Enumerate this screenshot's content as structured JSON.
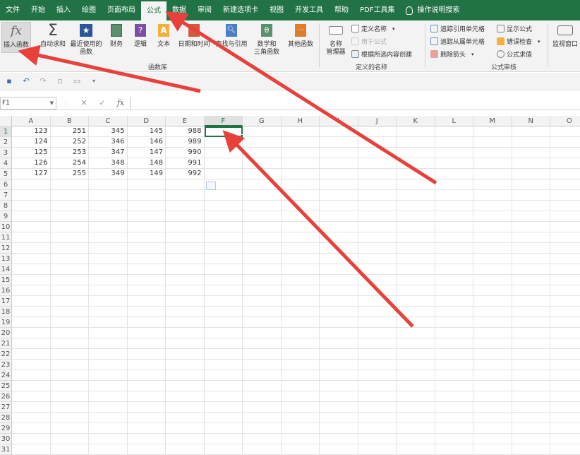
{
  "tabs": [
    "文件",
    "开始",
    "插入",
    "绘图",
    "页面布局",
    "公式",
    "数据",
    "审阅",
    "新建选项卡",
    "视图",
    "开发工具",
    "帮助",
    "PDF工具集"
  ],
  "active_tab": "公式",
  "tell_me": "操作说明搜索",
  "ribbon": {
    "function_library": {
      "label": "函数库",
      "buttons": {
        "insert_function": "插入函数",
        "autosum": "自动求和",
        "recent_1": "最近使用的",
        "recent_2": "函数",
        "financial": "财务",
        "logical": "逻辑",
        "text": "文本",
        "datetime": "日期和时间",
        "lookup": "查找与引用",
        "math_1": "数学和",
        "math_2": "三角函数",
        "more": "其他函数"
      }
    },
    "defined_names": {
      "label": "定义的名称",
      "name_manager_1": "名称",
      "name_manager_2": "管理器",
      "define_name": "定义名称",
      "use_in_formula": "用于公式",
      "create_from_selection": "根据所选内容创建"
    },
    "formula_auditing": {
      "label": "公式审核",
      "trace_precedents": "追踪引用单元格",
      "trace_dependents": "追踪从属单元格",
      "remove_arrows": "删除箭头",
      "show_formulas": "显示公式",
      "error_checking": "错误检查",
      "evaluate_formula": "公式求值"
    },
    "watch_window": "监视窗口"
  },
  "formula_bar": {
    "name_box": "F1",
    "cancel": "✕",
    "enter": "✓",
    "fx": "fx",
    "content": ""
  },
  "columns": [
    "A",
    "B",
    "C",
    "D",
    "E",
    "F",
    "G",
    "H",
    "I",
    "J",
    "K",
    "L",
    "M",
    "N",
    "O"
  ],
  "selected_column": "F",
  "rows": [
    "1",
    "2",
    "3",
    "4",
    "5",
    "6",
    "7",
    "8",
    "9",
    "10",
    "11",
    "12",
    "13",
    "14",
    "15",
    "16",
    "17",
    "18",
    "19",
    "20",
    "21",
    "22",
    "23",
    "24",
    "25",
    "26",
    "27",
    "28",
    "29",
    "30",
    "31"
  ],
  "selected_row": "1",
  "cells": [
    [
      "123",
      "251",
      "345",
      "145",
      "988"
    ],
    [
      "124",
      "252",
      "346",
      "146",
      "989"
    ],
    [
      "125",
      "253",
      "347",
      "147",
      "990"
    ],
    [
      "126",
      "254",
      "348",
      "148",
      "991"
    ],
    [
      "127",
      "255",
      "349",
      "149",
      "992"
    ]
  ],
  "colors": {
    "brand": "#217346",
    "arrow": "#e8403a"
  }
}
